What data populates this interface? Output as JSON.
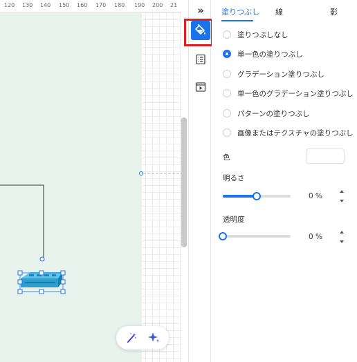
{
  "ruler": {
    "ticks": [
      "120",
      "130",
      "140",
      "150",
      "160",
      "170",
      "180",
      "190",
      "200",
      "21"
    ]
  },
  "rail": {
    "collapse_label": "»",
    "icons": [
      "paint-bucket-icon",
      "properties-list-icon",
      "presentation-icon"
    ],
    "active_index": 0
  },
  "panel": {
    "tabs": [
      {
        "label": "塗りつぶし",
        "active": true
      },
      {
        "label": "線",
        "active": false
      },
      {
        "label": "影",
        "active": false
      }
    ],
    "fill_options": [
      {
        "label": "塗りつぶしなし",
        "checked": false
      },
      {
        "label": "単一色の塗りつぶし",
        "checked": true
      },
      {
        "label": "グラデーション塗りつぶし",
        "checked": false
      },
      {
        "label": "単一色のグラデーション塗りつぶし",
        "checked": false
      },
      {
        "label": "パターンの塗りつぶし",
        "checked": false
      },
      {
        "label": "画像またはテクスチャの塗りつぶし",
        "checked": false
      }
    ],
    "color": {
      "label": "色",
      "value": "#ffffff"
    },
    "brightness": {
      "label": "明るさ",
      "value_text": "0 %",
      "slider_fraction": 0.5
    },
    "transparency": {
      "label": "透明度",
      "value_text": "0 %",
      "slider_fraction": 0.0
    }
  },
  "floating_tools": [
    "magic-wand-icon",
    "ai-sparkle-icon"
  ],
  "colors": {
    "accent": "#1a73e8",
    "highlight": "#e01e1e",
    "page_background": "#e9f3ee",
    "shape_blue": "#2a9fd0"
  }
}
